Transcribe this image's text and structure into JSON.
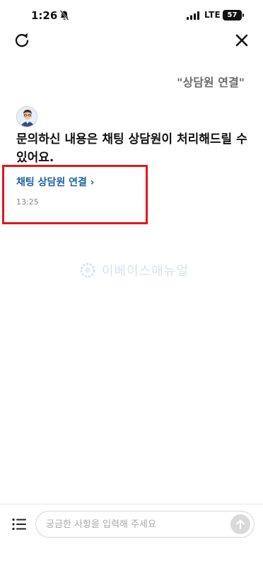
{
  "status_bar": {
    "time": "1:26",
    "network": "LTE",
    "battery": "57"
  },
  "header": {
    "refresh_icon": "refresh-icon",
    "close_icon": "close-icon"
  },
  "chat": {
    "user_message": "\"상담원 연결\"",
    "bot_message": "문의하신 내용은 채팅 상담원이 처리해드릴 수 있어요.",
    "connect_link": "채팅 상담원 연결 ›",
    "timestamp": "13:25"
  },
  "watermark": {
    "text": "이베이스매뉴얼"
  },
  "input_bar": {
    "placeholder": "궁금한 사항을 입력해 주세요",
    "value": ""
  },
  "colors": {
    "link": "#1f5fa8",
    "highlight": "#e5161d",
    "text": "#111111",
    "muted": "#888888"
  }
}
